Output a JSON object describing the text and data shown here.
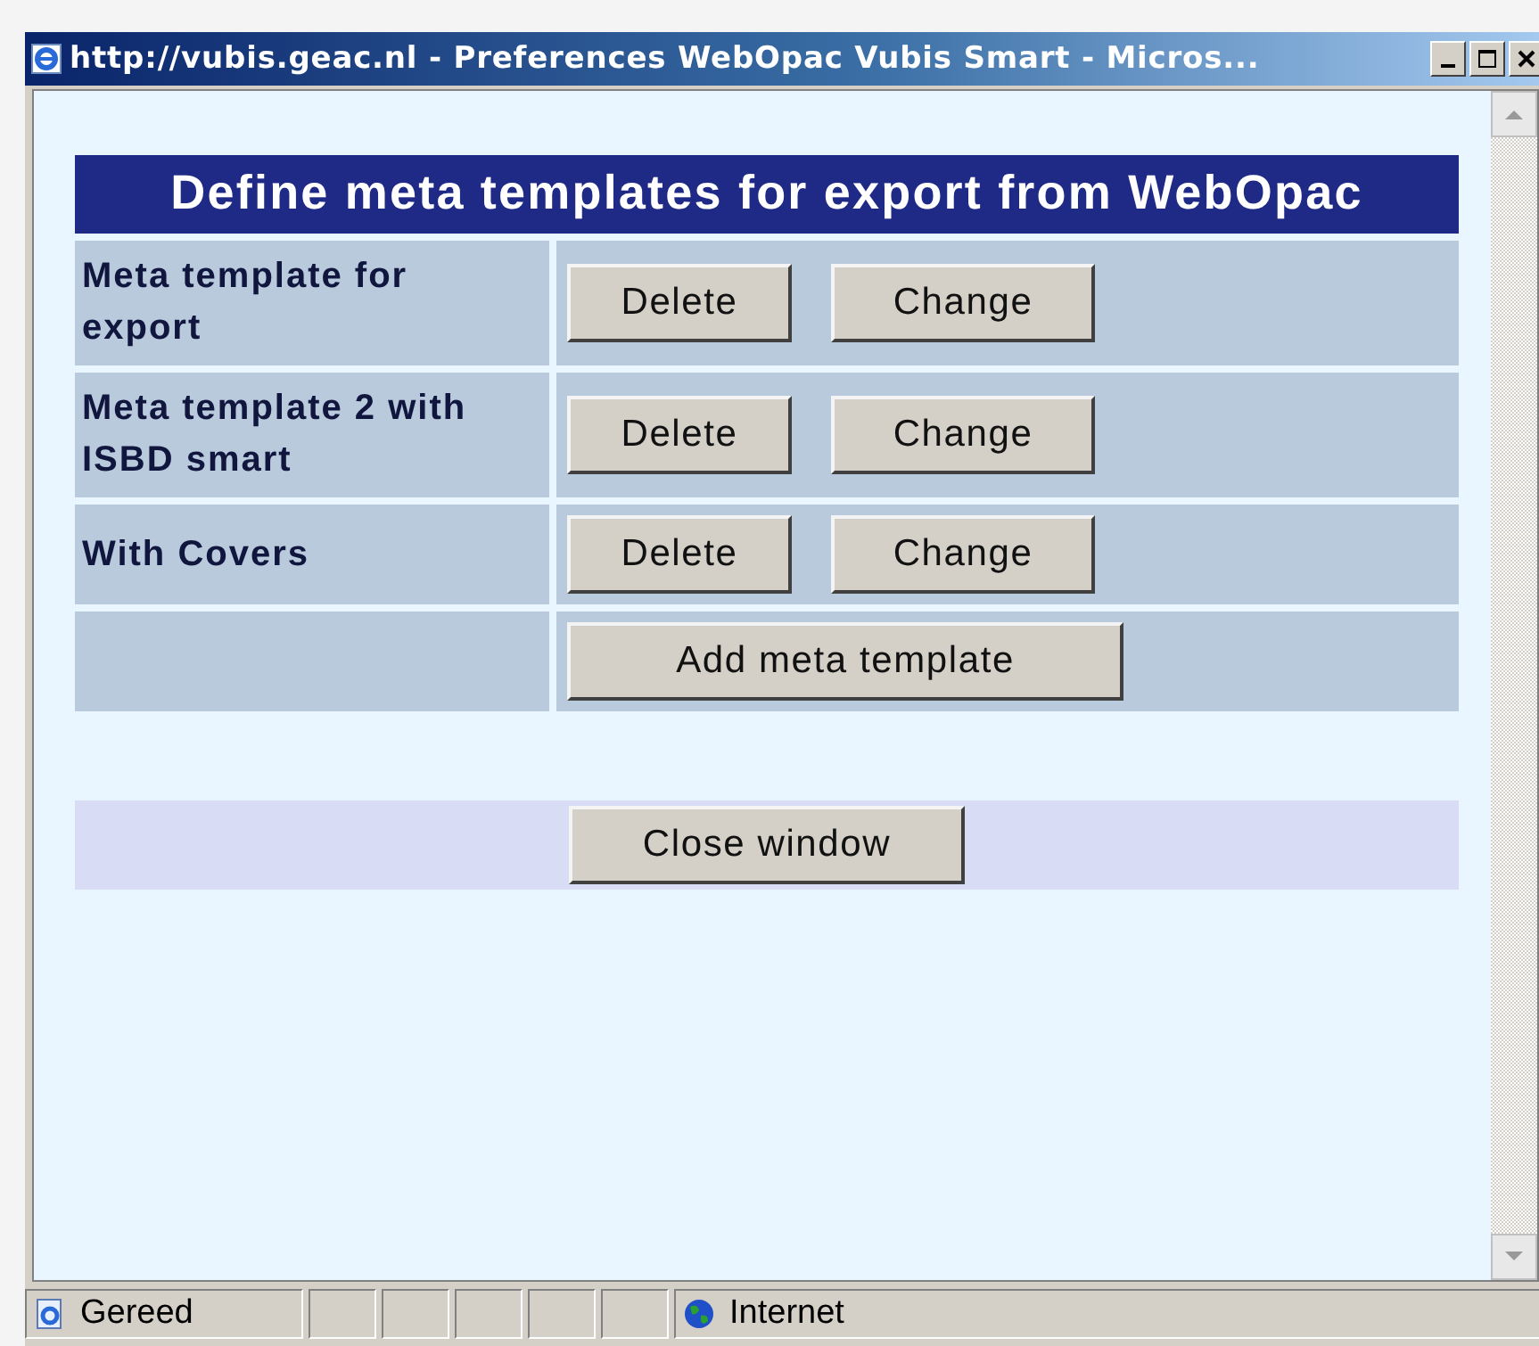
{
  "window": {
    "title": "http://vubis.geac.nl - Preferences WebOpac Vubis Smart - Micros..."
  },
  "table": {
    "heading": "Define meta templates for export from WebOpac",
    "rows": [
      {
        "name": "Meta template for export",
        "buttons": [
          "Delete",
          "Change"
        ]
      },
      {
        "name": "Meta template 2 with ISBD smart",
        "buttons": [
          "Delete",
          "Change"
        ]
      },
      {
        "name": "With Covers",
        "buttons": [
          "Delete",
          "Change"
        ]
      }
    ],
    "add_button": "Add meta template"
  },
  "close_button": "Close window",
  "status_bar": {
    "status": "Gereed",
    "zone": "Internet"
  }
}
